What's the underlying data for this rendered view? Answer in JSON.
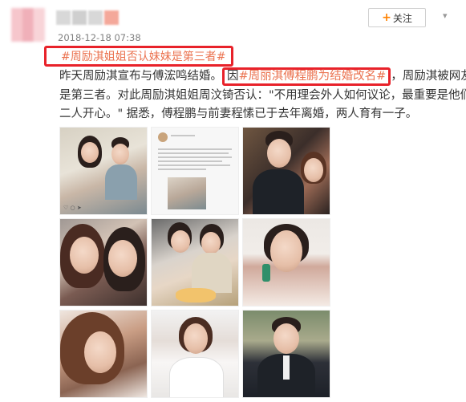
{
  "post": {
    "timestamp": "2018-12-18 07:38",
    "follow_label": "关注",
    "follow_plus": "+",
    "dropdown_glyph": "▾",
    "title_hashtag": "#周励淇姐姐否认妹妹是第三者#",
    "lines": {
      "l1_before": "昨天周励淇宣布与傅浤鸣结婚。",
      "l1_boxed_prefix": "因",
      "l1_tag": "#周丽淇傅程鹏为结婚改名#",
      "l1_after": "，周励淇被网友说",
      "l2": "是第三者。对此周励淇姐姐周汶锜否认：\"不用理会外人如何议论，最重要是他们",
      "l3": "二人开心。\" 据悉，傅程鹏与前妻程愫已于去年离婚，两人育有一子。"
    }
  },
  "images": [
    {
      "name": "photo-couple-instagram"
    },
    {
      "name": "photo-weibo-screenshot"
    },
    {
      "name": "photo-man-and-woman"
    },
    {
      "name": "photo-selfie-two-women"
    },
    {
      "name": "photo-two-women-cake"
    },
    {
      "name": "photo-woman-green-earring"
    },
    {
      "name": "photo-woman-hair-wind"
    },
    {
      "name": "photo-woman-white-dress"
    },
    {
      "name": "photo-man-in-suit"
    }
  ],
  "colors": {
    "hashtag": "#eb7350",
    "highlight_box": "#e8222a",
    "follow_plus": "#ff8200",
    "timestamp": "#808080"
  },
  "icons": {
    "follow": "plus-icon",
    "menu": "chevron-down-icon"
  }
}
